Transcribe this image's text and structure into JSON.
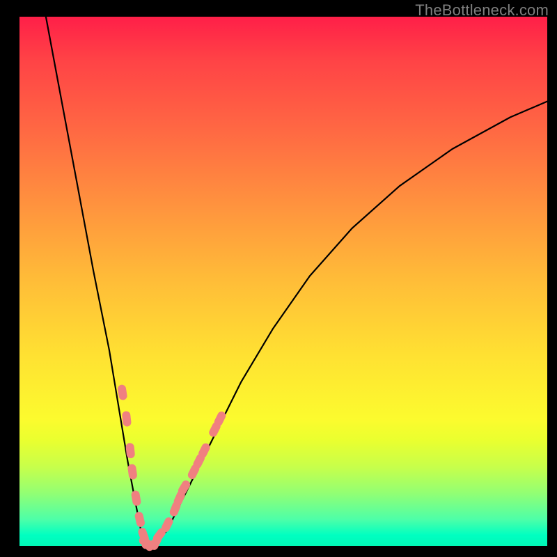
{
  "watermark": "TheBottleneck.com",
  "chart_data": {
    "type": "line",
    "title": "",
    "xlabel": "",
    "ylabel": "",
    "xlim": [
      0,
      100
    ],
    "ylim": [
      0,
      100
    ],
    "series": [
      {
        "name": "curve",
        "x": [
          5,
          8,
          11,
          14,
          17,
          19,
          20.5,
          22,
          23,
          24,
          25,
          26,
          28,
          30,
          33,
          37,
          42,
          48,
          55,
          63,
          72,
          82,
          93,
          100
        ],
        "y": [
          100,
          84,
          68,
          52,
          37,
          25,
          16,
          8,
          3,
          0.5,
          0,
          0.5,
          3,
          7,
          13,
          21,
          31,
          41,
          51,
          60,
          68,
          75,
          81,
          84
        ]
      }
    ],
    "markers": {
      "name": "highlight-dots",
      "color": "#f08080",
      "points": [
        {
          "x": 19.5,
          "y": 29
        },
        {
          "x": 20.3,
          "y": 24
        },
        {
          "x": 21.0,
          "y": 18
        },
        {
          "x": 21.4,
          "y": 14
        },
        {
          "x": 22.1,
          "y": 9
        },
        {
          "x": 22.8,
          "y": 5
        },
        {
          "x": 23.5,
          "y": 2
        },
        {
          "x": 24.0,
          "y": 0.6
        },
        {
          "x": 24.6,
          "y": 0.2
        },
        {
          "x": 25.2,
          "y": 0.2
        },
        {
          "x": 25.8,
          "y": 0.6
        },
        {
          "x": 26.5,
          "y": 2
        },
        {
          "x": 28.0,
          "y": 4
        },
        {
          "x": 29.5,
          "y": 7
        },
        {
          "x": 30.3,
          "y": 9
        },
        {
          "x": 31.2,
          "y": 11
        },
        {
          "x": 33.0,
          "y": 14
        },
        {
          "x": 34.0,
          "y": 16
        },
        {
          "x": 35.0,
          "y": 18
        },
        {
          "x": 37.0,
          "y": 22
        },
        {
          "x": 38.0,
          "y": 24
        }
      ]
    }
  }
}
